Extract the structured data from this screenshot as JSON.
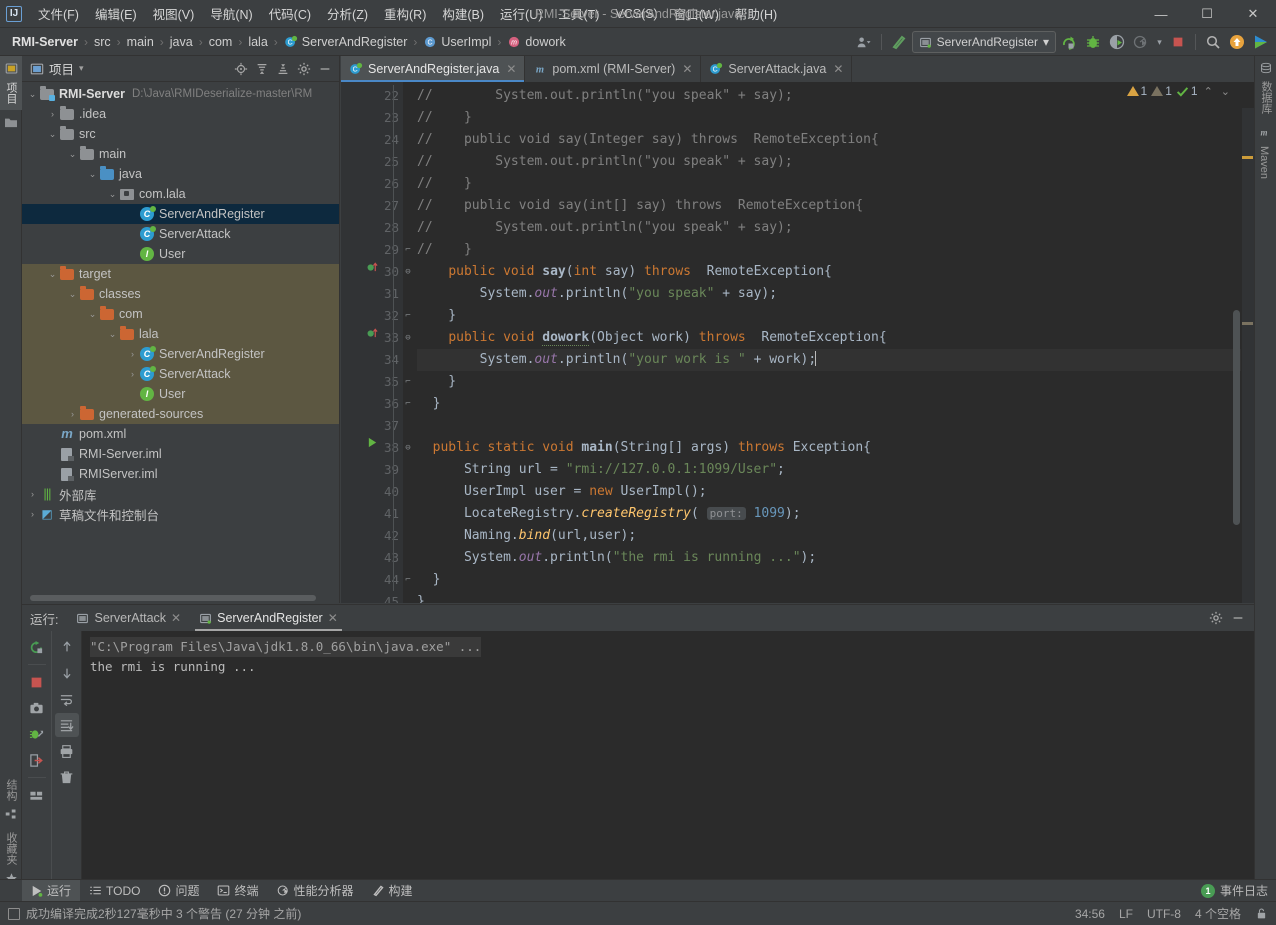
{
  "window": {
    "title": "RMI-Server - ServerAndRegister.java",
    "logo": "IJ",
    "minimize": "—",
    "maximize": "☐",
    "close": "✕"
  },
  "menu": [
    {
      "label": "文件(F)"
    },
    {
      "label": "编辑(E)"
    },
    {
      "label": "视图(V)"
    },
    {
      "label": "导航(N)"
    },
    {
      "label": "代码(C)"
    },
    {
      "label": "分析(Z)"
    },
    {
      "label": "重构(R)"
    },
    {
      "label": "构建(B)"
    },
    {
      "label": "运行(U)"
    },
    {
      "label": "工具(T)"
    },
    {
      "label": "VCS(S)"
    },
    {
      "label": "窗口(W)"
    },
    {
      "label": "帮助(H)"
    }
  ],
  "breadcrumb": [
    {
      "label": "RMI-Server",
      "icon": "none",
      "root": true
    },
    {
      "label": "src",
      "icon": "none"
    },
    {
      "label": "main",
      "icon": "none"
    },
    {
      "label": "java",
      "icon": "none"
    },
    {
      "label": "com",
      "icon": "none"
    },
    {
      "label": "lala",
      "icon": "none"
    },
    {
      "label": "ServerAndRegister",
      "icon": "class-icon"
    },
    {
      "label": "UserImpl",
      "icon": "interface-icon"
    },
    {
      "label": "dowork",
      "icon": "method-icon"
    }
  ],
  "toolbar": {
    "run_config": "ServerAndRegister",
    "run_config_caret": "▾",
    "icons": [
      {
        "name": "user-settings-icon",
        "glyph": "👤"
      },
      {
        "name": "hammer-build-icon",
        "glyph": "╱"
      },
      {
        "name": "run-icon",
        "glyph": "▶"
      },
      {
        "name": "debug-icon",
        "glyph": "🐞"
      },
      {
        "name": "run-coverage-icon",
        "glyph": "◑"
      },
      {
        "name": "profile-icon",
        "glyph": "◔"
      },
      {
        "name": "stop-icon",
        "glyph": "■"
      },
      {
        "name": "search-everywhere-icon",
        "glyph": "🔍"
      },
      {
        "name": "update-project-icon",
        "glyph": "↑"
      },
      {
        "name": "ide-play-icon",
        "glyph": "▶"
      }
    ]
  },
  "left_strip": {
    "top": [
      {
        "label": "项目",
        "name": "tool-tab-project",
        "active": true
      }
    ],
    "bottom": [
      {
        "label": "结构",
        "name": "tool-tab-structure"
      },
      {
        "label": "收藏夹",
        "name": "tool-tab-favorites"
      }
    ]
  },
  "right_strip": [
    {
      "label": "数据库",
      "name": "tool-tab-database"
    },
    {
      "label": "Maven",
      "name": "tool-tab-maven"
    }
  ],
  "project_panel": {
    "title": "项目",
    "caret": "▾",
    "actions": [
      {
        "name": "locate-file-icon",
        "glyph": "⊕"
      },
      {
        "name": "expand-all-icon",
        "glyph": "⩝"
      },
      {
        "name": "collapse-all-icon",
        "glyph": "⩞"
      },
      {
        "name": "settings-gear-icon",
        "glyph": "⚙"
      },
      {
        "name": "hide-panel-icon",
        "glyph": "—"
      }
    ],
    "tree": [
      {
        "indent": 0,
        "arrow": "⌄",
        "icon": "module-folder",
        "label": "RMI-Server",
        "bold": true,
        "path": "D:\\Java\\RMIDeserialize-master\\RM",
        "state": "normal"
      },
      {
        "indent": 1,
        "arrow": "›",
        "icon": "folder-gray",
        "label": ".idea",
        "state": "normal"
      },
      {
        "indent": 1,
        "arrow": "⌄",
        "icon": "folder-gray",
        "label": "src",
        "state": "normal"
      },
      {
        "indent": 2,
        "arrow": "⌄",
        "icon": "folder-gray",
        "label": "main",
        "state": "normal"
      },
      {
        "indent": 3,
        "arrow": "⌄",
        "icon": "folder-blue",
        "label": "java",
        "state": "normal"
      },
      {
        "indent": 4,
        "arrow": "⌄",
        "icon": "package",
        "label": "com.lala",
        "state": "normal"
      },
      {
        "indent": 5,
        "arrow": "",
        "icon": "class-icon",
        "label": "ServerAndRegister",
        "state": "selected"
      },
      {
        "indent": 5,
        "arrow": "",
        "icon": "class-icon",
        "label": "ServerAttack",
        "state": "normal"
      },
      {
        "indent": 5,
        "arrow": "",
        "icon": "interface-icon",
        "label": "User",
        "state": "normal"
      },
      {
        "indent": 1,
        "arrow": "⌄",
        "icon": "folder-orange",
        "label": "target",
        "state": "target"
      },
      {
        "indent": 2,
        "arrow": "⌄",
        "icon": "folder-orange",
        "label": "classes",
        "state": "target"
      },
      {
        "indent": 3,
        "arrow": "⌄",
        "icon": "folder-orange",
        "label": "com",
        "state": "target"
      },
      {
        "indent": 4,
        "arrow": "⌄",
        "icon": "folder-orange",
        "label": "lala",
        "state": "target"
      },
      {
        "indent": 5,
        "arrow": "›",
        "icon": "class-icon",
        "label": "ServerAndRegister",
        "state": "target"
      },
      {
        "indent": 5,
        "arrow": "›",
        "icon": "class-icon",
        "label": "ServerAttack",
        "state": "target"
      },
      {
        "indent": 5,
        "arrow": "",
        "icon": "interface-icon",
        "label": "User",
        "state": "target"
      },
      {
        "indent": 2,
        "arrow": "›",
        "icon": "folder-orange",
        "label": "generated-sources",
        "state": "target"
      },
      {
        "indent": 1,
        "arrow": "",
        "icon": "maven-icon",
        "label": "pom.xml",
        "state": "normal"
      },
      {
        "indent": 1,
        "arrow": "",
        "icon": "iml-icon",
        "label": "RMI-Server.iml",
        "state": "normal"
      },
      {
        "indent": 1,
        "arrow": "",
        "icon": "iml-icon",
        "label": "RMIServer.iml",
        "state": "normal"
      },
      {
        "indent": 0,
        "arrow": "›",
        "icon": "library-icon",
        "label": "外部库",
        "state": "normal"
      },
      {
        "indent": 0,
        "arrow": "›",
        "icon": "scratch-icon",
        "label": "草稿文件和控制台",
        "state": "normal"
      }
    ]
  },
  "editor": {
    "tabs": [
      {
        "label": "ServerAndRegister.java",
        "icon": "class-icon",
        "active": true,
        "close": "✕"
      },
      {
        "label": "pom.xml (RMI-Server)",
        "icon": "maven-icon",
        "active": false,
        "close": "✕"
      },
      {
        "label": "ServerAttack.java",
        "icon": "class-icon",
        "active": false,
        "close": "✕"
      }
    ],
    "inspections": {
      "warning_count": "1",
      "weak_warning_count": "1",
      "ok_count": "1",
      "prev": "⌃",
      "next": "⌄"
    },
    "first_line": 22,
    "lines": [
      {
        "n": 22,
        "marker": "",
        "fold": "",
        "html": "<span class=\"cmt\">//        System.out.println(\"you speak\" + say);</span>"
      },
      {
        "n": 23,
        "marker": "",
        "fold": "",
        "html": "<span class=\"cmt\">//    }</span>"
      },
      {
        "n": 24,
        "marker": "",
        "fold": "",
        "html": "<span class=\"cmt\">//    public void say(Integer say) throws  RemoteException{</span>"
      },
      {
        "n": 25,
        "marker": "",
        "fold": "",
        "html": "<span class=\"cmt\">//        System.out.println(\"you speak\" + say);</span>"
      },
      {
        "n": 26,
        "marker": "",
        "fold": "",
        "html": "<span class=\"cmt\">//    }</span>"
      },
      {
        "n": 27,
        "marker": "",
        "fold": "",
        "html": "<span class=\"cmt\">//    public void say(int[] say) throws  RemoteException{</span>"
      },
      {
        "n": 28,
        "marker": "",
        "fold": "",
        "html": "<span class=\"cmt\">//        System.out.println(\"you speak\" + say);</span>"
      },
      {
        "n": 29,
        "marker": "",
        "fold": "⌐",
        "html": "<span class=\"cmt\">//    }</span>"
      },
      {
        "n": 30,
        "marker": "override",
        "fold": "⊖",
        "html": "    <span class=\"kw\">public</span> <span class=\"kw\">void</span> <span class=\"mthb\">say</span>(<span class=\"kw\">int</span> say) <span class=\"kw\">throws</span>  RemoteException{"
      },
      {
        "n": 31,
        "marker": "",
        "fold": "",
        "html": "        System.<span class=\"fld\">out</span>.println(<span class=\"str\">\"you speak\"</span> + say);"
      },
      {
        "n": 32,
        "marker": "",
        "fold": "⌐",
        "html": "    }"
      },
      {
        "n": 33,
        "marker": "override",
        "fold": "⊖",
        "html": "    <span class=\"kw\">public</span> <span class=\"kw\">void</span> <span class=\"mthd\">dowork</span>(Object work) <span class=\"kw\">throws</span>  RemoteException{"
      },
      {
        "n": 34,
        "marker": "",
        "fold": "",
        "current": true,
        "html": "        System.<span class=\"fld\">out</span>.println(<span class=\"str\">\"your work is \"</span> + work);<span class=\"caret\"></span>"
      },
      {
        "n": 35,
        "marker": "",
        "fold": "⌐",
        "html": "    }"
      },
      {
        "n": 36,
        "marker": "",
        "fold": "⌐",
        "html": "  }"
      },
      {
        "n": 37,
        "marker": "",
        "fold": "",
        "html": ""
      },
      {
        "n": 38,
        "marker": "run",
        "fold": "⊖",
        "html": "  <span class=\"kw\">public</span> <span class=\"kw\">static</span> <span class=\"kw\">void</span> <span class=\"mthb\">main</span>(String[] args) <span class=\"kw\">throws</span> Exception{"
      },
      {
        "n": 39,
        "marker": "",
        "fold": "",
        "html": "      String url = <span class=\"str\">\"rmi://127.0.0.1:1099/User\"</span>;"
      },
      {
        "n": 40,
        "marker": "",
        "fold": "",
        "html": "      UserImpl user = <span class=\"kw\">new</span> UserImpl();"
      },
      {
        "n": 41,
        "marker": "",
        "fold": "",
        "html": "      LocateRegistry.<span class=\"mth\" style=\"font-style:italic\">createRegistry</span>( <span class=\"hint\">port:</span> <span class=\"num\">1099</span>);"
      },
      {
        "n": 42,
        "marker": "",
        "fold": "",
        "html": "      Naming.<span class=\"mth\" style=\"font-style:italic\">bind</span>(url,user);"
      },
      {
        "n": 43,
        "marker": "",
        "fold": "",
        "html": "      System.<span class=\"fld\">out</span>.println(<span class=\"str\">\"the rmi is running ...\"</span>);"
      },
      {
        "n": 44,
        "marker": "",
        "fold": "⌐",
        "html": "  }"
      },
      {
        "n": 45,
        "marker": "",
        "fold": "",
        "html": "}"
      }
    ]
  },
  "run_panel": {
    "label": "运行:",
    "tabs": [
      {
        "label": "ServerAttack",
        "active": false,
        "close": "✕",
        "icon": "run-config-icon"
      },
      {
        "label": "ServerAndRegister",
        "active": true,
        "close": "✕",
        "icon": "run-config-live-icon"
      }
    ],
    "header_actions": [
      {
        "name": "settings-gear-icon",
        "glyph": "⚙"
      },
      {
        "name": "hide-panel-icon",
        "glyph": "—"
      }
    ],
    "tools_left": [
      {
        "name": "rerun-icon",
        "glyph": "↻",
        "color": "#499c54"
      },
      {
        "name": "stop-icon",
        "glyph": "■",
        "color": "#c75450"
      },
      {
        "name": "screenshot-icon",
        "glyph": "📷",
        "color": "#a3a3a3"
      },
      {
        "name": "dump-threads-icon",
        "glyph": "↯",
        "color": "#62b543"
      },
      {
        "name": "export-icon",
        "glyph": "⇥",
        "color": "#c75450"
      },
      {
        "name": "layout-icon",
        "glyph": "▤",
        "color": "#a3a3a3"
      }
    ],
    "tools_right": [
      {
        "name": "scroll-up-icon",
        "glyph": "↑"
      },
      {
        "name": "scroll-down-icon",
        "glyph": "↓"
      },
      {
        "name": "soft-wrap-icon",
        "glyph": "↵"
      },
      {
        "name": "scroll-to-end-icon",
        "glyph": "↧",
        "on": true
      },
      {
        "name": "print-icon",
        "glyph": "⎙"
      },
      {
        "name": "clear-all-icon",
        "glyph": "🗑"
      }
    ],
    "console": {
      "command": "\"C:\\Program Files\\Java\\jdk1.8.0_66\\bin\\java.exe\" ...",
      "output": "the rmi is running ..."
    }
  },
  "bottom_bar": {
    "items": [
      {
        "label": "运行",
        "icon": "run-icon",
        "active": true
      },
      {
        "label": "TODO",
        "icon": "todo-icon",
        "active": false
      },
      {
        "label": "问题",
        "icon": "problems-icon",
        "active": false
      },
      {
        "label": "终端",
        "icon": "terminal-icon",
        "active": false
      },
      {
        "label": "性能分析器",
        "icon": "profiler-icon",
        "active": false
      },
      {
        "label": "构建",
        "icon": "build-icon",
        "active": false
      }
    ],
    "event_log": {
      "label": "事件日志",
      "count": "1"
    }
  },
  "status_bar": {
    "message": "成功编译完成2秒127毫秒中 3 个警告 (27 分钟 之前)",
    "caret_position": "34:56",
    "line_separator": "LF",
    "encoding": "UTF-8",
    "indent": "4 个空格",
    "lock_icon": "🔓"
  },
  "colors": {
    "accent_blue": "#4a88c7",
    "selection": "#0d293e",
    "target_folder": "#5c5741",
    "keyword": "#cc7832",
    "string": "#6a8759",
    "number": "#6897bb",
    "field": "#9876aa",
    "comment": "#808080",
    "method": "#ffc66d",
    "editor_bg": "#2b2b2b",
    "panel_bg": "#3c3f41"
  }
}
